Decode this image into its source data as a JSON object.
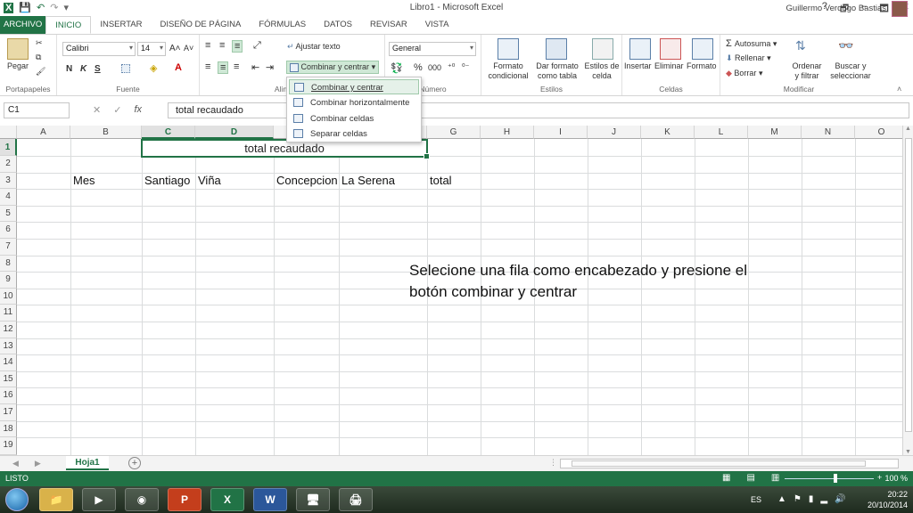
{
  "window": {
    "title": "Libro1 - Microsoft Excel",
    "controls": [
      "?",
      "🗗",
      "–",
      "🗖",
      "✕"
    ]
  },
  "quick_access": {
    "save_icon": "save-icon",
    "undo_icon": "undo-icon",
    "redo_icon": "redo-icon"
  },
  "tabs": [
    "ARCHIVO",
    "INICIO",
    "INSERTAR",
    "DISEÑO DE PÁGINA",
    "FÓRMULAS",
    "DATOS",
    "REVISAR",
    "VISTA"
  ],
  "user": {
    "name": "Guillermo Verdugo Bastias"
  },
  "ribbon": {
    "clipboard": {
      "label": "Portapapeles",
      "paste": "Pegar"
    },
    "font": {
      "label": "Fuente",
      "family": "Calibri",
      "size": "14",
      "bold": "N",
      "italic": "K",
      "underline": "S"
    },
    "alignment": {
      "label": "Alineación",
      "wrap": "Ajustar texto",
      "merge": "Combinar y centrar"
    },
    "number": {
      "label": "Número",
      "format": "General",
      "percent": "%",
      "thousands": "000"
    },
    "styles": {
      "label": "Estilos",
      "conditional": "Formato condicional",
      "as_table": "Dar formato como tabla",
      "cell_styles": "Estilos de celda"
    },
    "cells": {
      "label": "Celdas",
      "insert": "Insertar",
      "delete": "Eliminar",
      "format": "Formato"
    },
    "editing": {
      "label": "Modificar",
      "autosum": "Autosuma",
      "fill": "Rellenar",
      "clear": "Borrar",
      "sort": "Ordenar y filtrar",
      "find": "Buscar y seleccionar"
    }
  },
  "merge_menu": {
    "items": [
      "Combinar y centrar",
      "Combinar horizontalmente",
      "Combinar celdas",
      "Separar celdas"
    ]
  },
  "formula_bar": {
    "name_box": "C1",
    "fx": "fx",
    "content": "total recaudado"
  },
  "grid": {
    "columns": [
      "A",
      "B",
      "C",
      "D",
      "E",
      "F",
      "G",
      "H",
      "I",
      "J",
      "K",
      "L",
      "M",
      "N",
      "O"
    ],
    "selected_columns": [
      "C",
      "D"
    ],
    "rows": [
      "1",
      "2",
      "3",
      "4",
      "5",
      "6",
      "7",
      "8",
      "9",
      "10",
      "11",
      "12",
      "13",
      "14",
      "15",
      "16",
      "17",
      "18",
      "19"
    ],
    "selected_row": "1",
    "merged_cell": "total recaudado",
    "row3": {
      "B": "Mes",
      "C": "Santiago",
      "D": "Viña",
      "E": "Concepcion",
      "F": "La Serena",
      "G": "total"
    }
  },
  "note": "Selecione una fila como encabezado y presione el botón combinar y centrar",
  "sheets": {
    "active": "Hoja1",
    "add": "+"
  },
  "status": {
    "ready": "LISTO",
    "zoom": "100 %"
  },
  "taskbar": {
    "apps": [
      "explorer",
      "media",
      "chrome",
      "powerpoint",
      "excel",
      "word",
      "monitor",
      "printer"
    ],
    "lang": "ES",
    "time": "20:22",
    "date": "20/10/2014"
  }
}
